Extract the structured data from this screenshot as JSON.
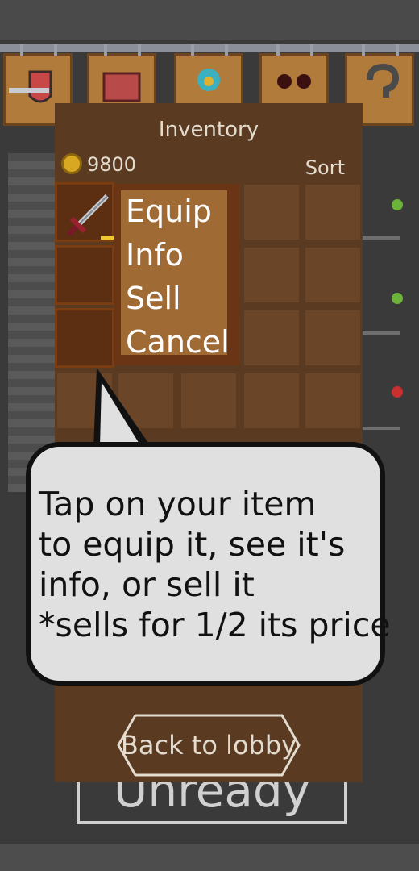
{
  "background": {
    "unready_label": "Unready",
    "status_dots": [
      "#6cb33a",
      "#6cb33a",
      "#c83030"
    ],
    "shop_signs": [
      "sword-shield-sign",
      "scroll-sign",
      "gem-sign",
      "enemy-sign",
      "question-sign"
    ]
  },
  "inventory": {
    "title": "Inventory",
    "gold": "9800",
    "sort_label": "Sort",
    "selected_item": "sword-icon"
  },
  "context_menu": {
    "items": [
      "Equip",
      "Info",
      "Sell",
      "Cancel"
    ]
  },
  "tutorial": {
    "line1": "Tap on your item",
    "line2": "to equip it, see it's",
    "line3": "info, or sell it",
    "line4": "*sells for 1/2 its price"
  },
  "back_button": {
    "label": "Back to lobby"
  },
  "colors": {
    "panel": "#5b3a22",
    "menu_bg": "#a06a35",
    "bubble": "#e0e0e0"
  }
}
